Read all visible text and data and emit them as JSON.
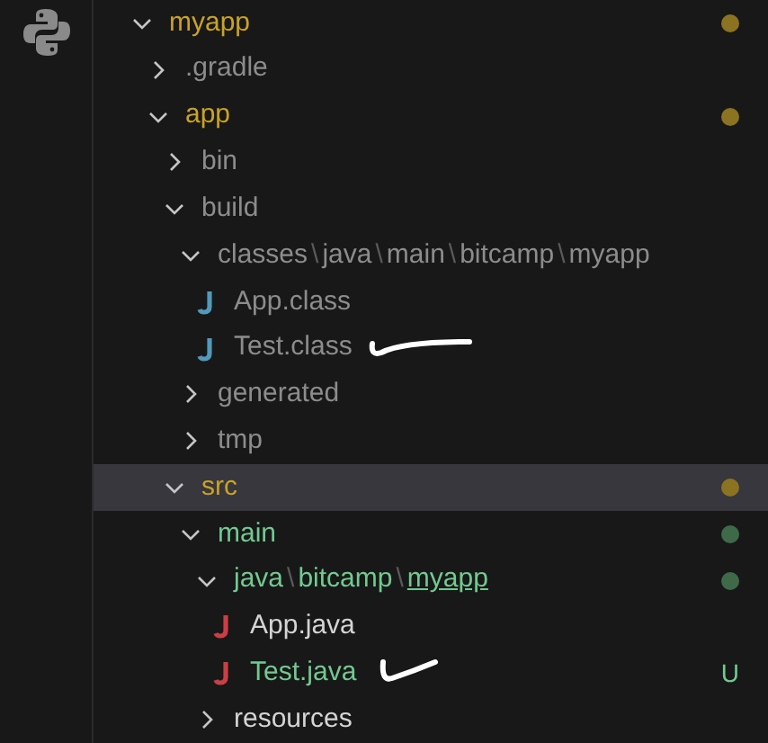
{
  "explorer": {
    "tree": [
      {
        "kind": "folder",
        "segments": [
          {
            "text": "myapp",
            "underlined": false
          }
        ],
        "expanded": true,
        "color": "#c9a227",
        "dot": {
          "color": "#8b7322"
        },
        "selected": false,
        "scribble": false,
        "children": [
          {
            "kind": "folder",
            "segments": [
              {
                "text": ".gradle",
                "underlined": false
              }
            ],
            "expanded": false,
            "color": "#8c8c8c",
            "selected": false,
            "scribble": false
          },
          {
            "kind": "folder",
            "segments": [
              {
                "text": "app",
                "underlined": false
              }
            ],
            "expanded": true,
            "color": "#c9a227",
            "dot": {
              "color": "#8b7322"
            },
            "selected": false,
            "scribble": false,
            "children": [
              {
                "kind": "folder",
                "segments": [
                  {
                    "text": "bin",
                    "underlined": false
                  }
                ],
                "expanded": false,
                "color": "#8c8c8c",
                "selected": false,
                "scribble": false
              },
              {
                "kind": "folder",
                "segments": [
                  {
                    "text": "build",
                    "underlined": false
                  }
                ],
                "expanded": true,
                "color": "#8c8c8c",
                "selected": false,
                "scribble": false,
                "children": [
                  {
                    "kind": "folder",
                    "separator": "\\",
                    "segments": [
                      {
                        "text": "classes",
                        "underlined": false
                      },
                      {
                        "text": "java",
                        "underlined": false
                      },
                      {
                        "text": "main",
                        "underlined": false
                      },
                      {
                        "text": "bitcamp",
                        "underlined": false
                      },
                      {
                        "text": "myapp",
                        "underlined": false
                      }
                    ],
                    "expanded": true,
                    "color": "#8c8c8c",
                    "selected": false,
                    "scribble": false,
                    "children": [
                      {
                        "kind": "class",
                        "segments": [
                          {
                            "text": "App.class",
                            "underlined": false
                          }
                        ],
                        "color": "#8c8c8c",
                        "selected": false,
                        "scribble": false
                      },
                      {
                        "kind": "class",
                        "segments": [
                          {
                            "text": "Test.class",
                            "underlined": false
                          }
                        ],
                        "color": "#8c8c8c",
                        "selected": false,
                        "scribble": true
                      }
                    ]
                  },
                  {
                    "kind": "folder",
                    "segments": [
                      {
                        "text": "generated",
                        "underlined": false
                      }
                    ],
                    "expanded": false,
                    "color": "#8c8c8c",
                    "selected": false,
                    "scribble": false
                  },
                  {
                    "kind": "folder",
                    "segments": [
                      {
                        "text": "tmp",
                        "underlined": false
                      }
                    ],
                    "expanded": false,
                    "color": "#8c8c8c",
                    "selected": false,
                    "scribble": false
                  }
                ]
              },
              {
                "kind": "folder",
                "segments": [
                  {
                    "text": "src",
                    "underlined": false
                  }
                ],
                "expanded": true,
                "color": "#c9a227",
                "dot": {
                  "color": "#8b7322"
                },
                "selected": true,
                "scribble": false,
                "children": [
                  {
                    "kind": "folder",
                    "segments": [
                      {
                        "text": "main",
                        "underlined": false
                      }
                    ],
                    "expanded": true,
                    "color": "#73c991",
                    "dot": {
                      "color": "#3f6a4a"
                    },
                    "selected": false,
                    "scribble": false,
                    "children": [
                      {
                        "kind": "folder",
                        "separator": "\\",
                        "segments": [
                          {
                            "text": "java",
                            "underlined": false
                          },
                          {
                            "text": "bitcamp",
                            "underlined": false
                          },
                          {
                            "text": "myapp",
                            "underlined": true
                          }
                        ],
                        "expanded": true,
                        "color": "#73c991",
                        "dot": {
                          "color": "#3f6a4a"
                        },
                        "selected": false,
                        "scribble": false,
                        "children": [
                          {
                            "kind": "java",
                            "segments": [
                              {
                                "text": "App.java",
                                "underlined": false
                              }
                            ],
                            "color": "#d4d4d4",
                            "selected": false,
                            "scribble": false
                          },
                          {
                            "kind": "java",
                            "segments": [
                              {
                                "text": "Test.java",
                                "underlined": false
                              }
                            ],
                            "color": "#73c991",
                            "badge": "U",
                            "selected": false,
                            "scribble": true
                          }
                        ]
                      },
                      {
                        "kind": "folder",
                        "segments": [
                          {
                            "text": "resources",
                            "underlined": false
                          }
                        ],
                        "expanded": false,
                        "color": "#d4d4d4",
                        "selected": false,
                        "scribble": false
                      }
                    ]
                  }
                ]
              }
            ]
          }
        ]
      }
    ]
  }
}
